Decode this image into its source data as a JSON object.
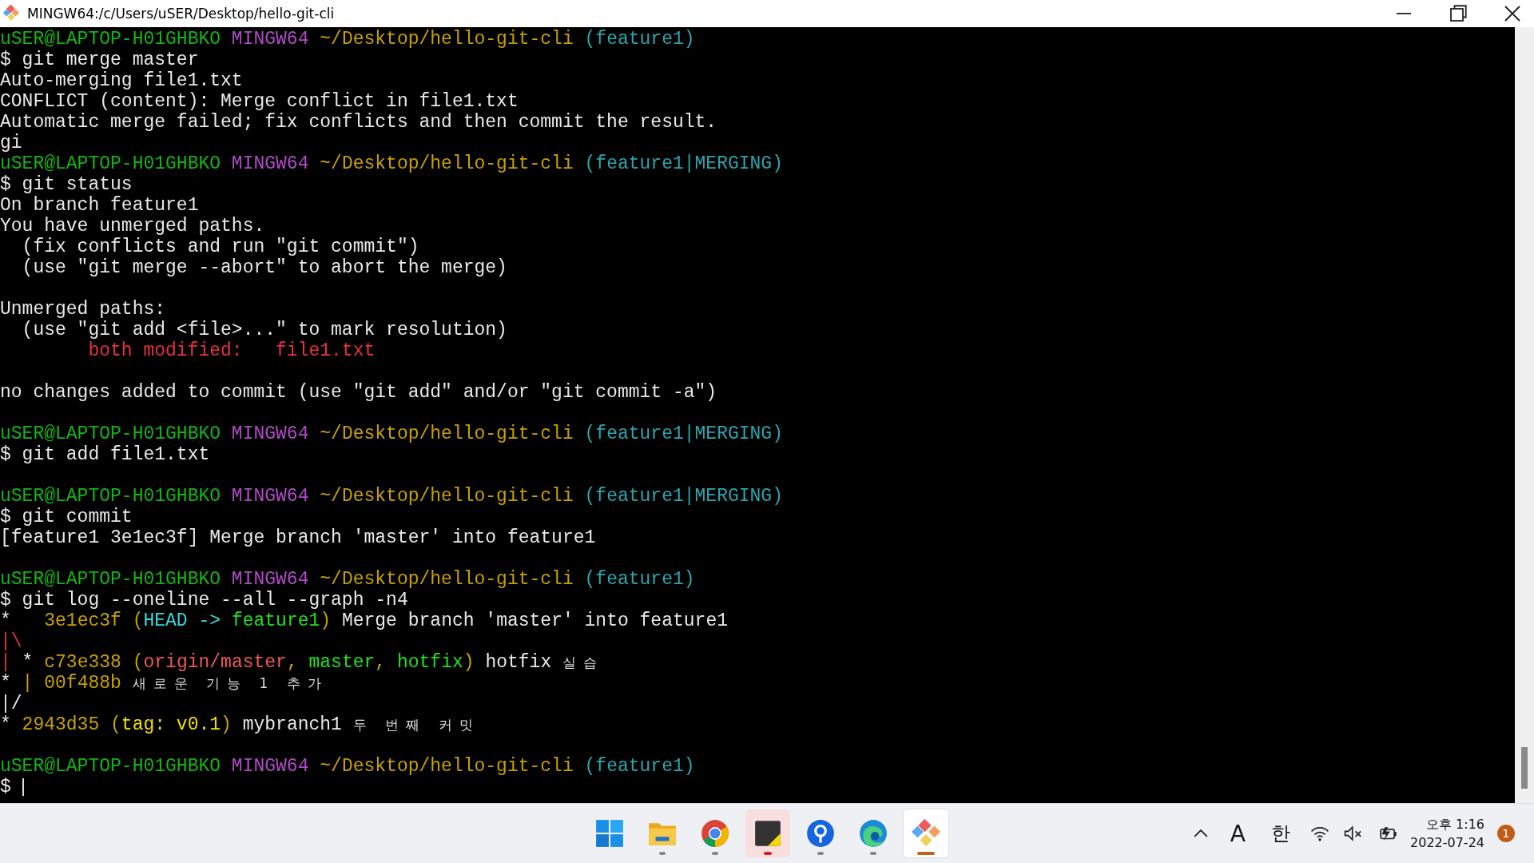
{
  "window": {
    "title": "MINGW64:/c/Users/uSER/Desktop/hello-git-cli"
  },
  "terminal": {
    "blocks": [
      {
        "lines": [
          {
            "segments": [
              {
                "text": "uSER@LAPTOP-H01GHBKO",
                "kind": "user"
              },
              {
                "text": " MINGW64",
                "kind": "host"
              },
              {
                "text": " ~/Desktop/hello-git-cli",
                "kind": "path"
              },
              {
                "text": " (feature1)",
                "kind": "branch"
              }
            ]
          },
          {
            "segments": [
              {
                "text": "$ git merge master",
                "kind": "plain"
              }
            ]
          },
          {
            "segments": [
              {
                "text": "Auto-merging file1.txt",
                "kind": "plain"
              }
            ]
          },
          {
            "segments": [
              {
                "text": "CONFLICT (content): Merge conflict in file1.txt",
                "kind": "plain"
              }
            ]
          },
          {
            "segments": [
              {
                "text": "Automatic merge failed; fix conflicts and then commit the result.",
                "kind": "plain"
              }
            ]
          },
          {
            "segments": [
              {
                "text": "gi",
                "kind": "plain"
              }
            ]
          },
          {
            "segments": [
              {
                "text": "uSER@LAPTOP-H01GHBKO",
                "kind": "user"
              },
              {
                "text": " MINGW64",
                "kind": "host"
              },
              {
                "text": " ~/Desktop/hello-git-cli",
                "kind": "path"
              },
              {
                "text": " (feature1|MERGING)",
                "kind": "branch"
              }
            ]
          },
          {
            "segments": [
              {
                "text": "$ git status",
                "kind": "plain"
              }
            ]
          },
          {
            "segments": [
              {
                "text": "On branch feature1",
                "kind": "plain"
              }
            ]
          },
          {
            "segments": [
              {
                "text": "You have unmerged paths.",
                "kind": "plain"
              }
            ]
          },
          {
            "segments": [
              {
                "text": "  (fix conflicts and run \"git commit\")",
                "kind": "plain"
              }
            ]
          },
          {
            "segments": [
              {
                "text": "  (use \"git merge --abort\" to abort the merge)",
                "kind": "plain"
              }
            ]
          }
        ]
      },
      {
        "lines": [
          {
            "segments": [
              {
                "text": "Unmerged paths:",
                "kind": "plain"
              }
            ]
          },
          {
            "segments": [
              {
                "text": "  (use \"git add <file>...\" to mark resolution)",
                "kind": "plain"
              }
            ]
          },
          {
            "segments": [
              {
                "text": "        both modified:   file1.txt",
                "kind": "red"
              }
            ]
          }
        ]
      },
      {
        "lines": [
          {
            "segments": [
              {
                "text": "no changes added to commit (use \"git add\" and/or \"git commit -a\")",
                "kind": "plain"
              }
            ]
          }
        ]
      },
      {
        "lines": [
          {
            "segments": [
              {
                "text": "uSER@LAPTOP-H01GHBKO",
                "kind": "user"
              },
              {
                "text": " MINGW64",
                "kind": "host"
              },
              {
                "text": " ~/Desktop/hello-git-cli",
                "kind": "path"
              },
              {
                "text": " (feature1|MERGING)",
                "kind": "branch"
              }
            ]
          },
          {
            "segments": [
              {
                "text": "$ git add file1.txt",
                "kind": "plain"
              }
            ]
          }
        ]
      },
      {
        "lines": [
          {
            "segments": [
              {
                "text": "uSER@LAPTOP-H01GHBKO",
                "kind": "user"
              },
              {
                "text": " MINGW64",
                "kind": "host"
              },
              {
                "text": " ~/Desktop/hello-git-cli",
                "kind": "path"
              },
              {
                "text": " (feature1|MERGING)",
                "kind": "branch"
              }
            ]
          },
          {
            "segments": [
              {
                "text": "$ git commit",
                "kind": "plain"
              }
            ]
          },
          {
            "segments": [
              {
                "text": "[feature1 3e1ec3f] Merge branch 'master' into feature1",
                "kind": "plain"
              }
            ]
          }
        ]
      },
      {
        "lines": [
          {
            "segments": [
              {
                "text": "uSER@LAPTOP-H01GHBKO",
                "kind": "user"
              },
              {
                "text": " MINGW64",
                "kind": "host"
              },
              {
                "text": " ~/Desktop/hello-git-cli",
                "kind": "path"
              },
              {
                "text": " (feature1)",
                "kind": "branch"
              }
            ]
          },
          {
            "segments": [
              {
                "text": "$ git log --oneline --all --graph -n4",
                "kind": "plain"
              }
            ]
          },
          {
            "segments": [
              {
                "text": "*   ",
                "kind": "plain"
              },
              {
                "text": "3e1ec3f (",
                "kind": "hash"
              },
              {
                "text": "HEAD -> ",
                "kind": "head"
              },
              {
                "text": "feature1",
                "kind": "local"
              },
              {
                "text": ")",
                "kind": "hash"
              },
              {
                "text": " Merge branch 'master' into feature1",
                "kind": "plain"
              }
            ]
          },
          {
            "segments": [
              {
                "text": "|\\",
                "kind": "graph"
              }
            ]
          },
          {
            "segments": [
              {
                "text": "|",
                "kind": "graph"
              },
              {
                "text": " * ",
                "kind": "plain"
              },
              {
                "text": "c73e338 (",
                "kind": "hash"
              },
              {
                "text": "origin/master",
                "kind": "remote"
              },
              {
                "text": ", ",
                "kind": "hash"
              },
              {
                "text": "master",
                "kind": "local"
              },
              {
                "text": ", ",
                "kind": "hash"
              },
              {
                "text": "hotfix",
                "kind": "local"
              },
              {
                "text": ")",
                "kind": "hash"
              },
              {
                "text": " hotfix ",
                "kind": "plain"
              },
              {
                "text": "실습",
                "kind": "wide"
              }
            ]
          },
          {
            "segments": [
              {
                "text": "* ",
                "kind": "plain"
              },
              {
                "text": "| ",
                "kind": "hash"
              },
              {
                "text": "00f488b ",
                "kind": "hash"
              },
              {
                "text": "새로운 기능 1 추가",
                "kind": "wide"
              }
            ]
          },
          {
            "segments": [
              {
                "text": "|/",
                "kind": "plain"
              }
            ]
          },
          {
            "segments": [
              {
                "text": "* ",
                "kind": "plain"
              },
              {
                "text": "2943d35 (",
                "kind": "hash"
              },
              {
                "text": "tag: v0.1",
                "kind": "tag"
              },
              {
                "text": ")",
                "kind": "hash"
              },
              {
                "text": " mybranch1 ",
                "kind": "plain"
              },
              {
                "text": "두 번째 커밋",
                "kind": "wide"
              }
            ]
          }
        ]
      },
      {
        "lines": [
          {
            "segments": [
              {
                "text": "uSER@LAPTOP-H01GHBKO",
                "kind": "user"
              },
              {
                "text": " MINGW64",
                "kind": "host"
              },
              {
                "text": " ~/Desktop/hello-git-cli",
                "kind": "path"
              },
              {
                "text": " (feature1)",
                "kind": "branch"
              }
            ]
          }
        ]
      }
    ],
    "prompt": "$"
  },
  "taskbar": {
    "apps": [
      {
        "kind": "start",
        "running": false,
        "attention": false,
        "selected": false
      },
      {
        "kind": "folder",
        "running": true,
        "attention": false,
        "selected": false
      },
      {
        "kind": "browser",
        "running": true,
        "attention": false,
        "selected": false
      },
      {
        "kind": "notes",
        "running": true,
        "attention": true,
        "selected": false
      },
      {
        "kind": "pin",
        "running": true,
        "attention": false,
        "selected": false
      },
      {
        "kind": "edge",
        "running": true,
        "attention": false,
        "selected": false
      },
      {
        "kind": "git",
        "running": true,
        "attention": false,
        "selected": true
      }
    ],
    "tray": {
      "ime_mode": "A",
      "ime_lang": "한",
      "time": "오후 1:16",
      "date": "2022-07-24",
      "notifications": "1"
    }
  }
}
